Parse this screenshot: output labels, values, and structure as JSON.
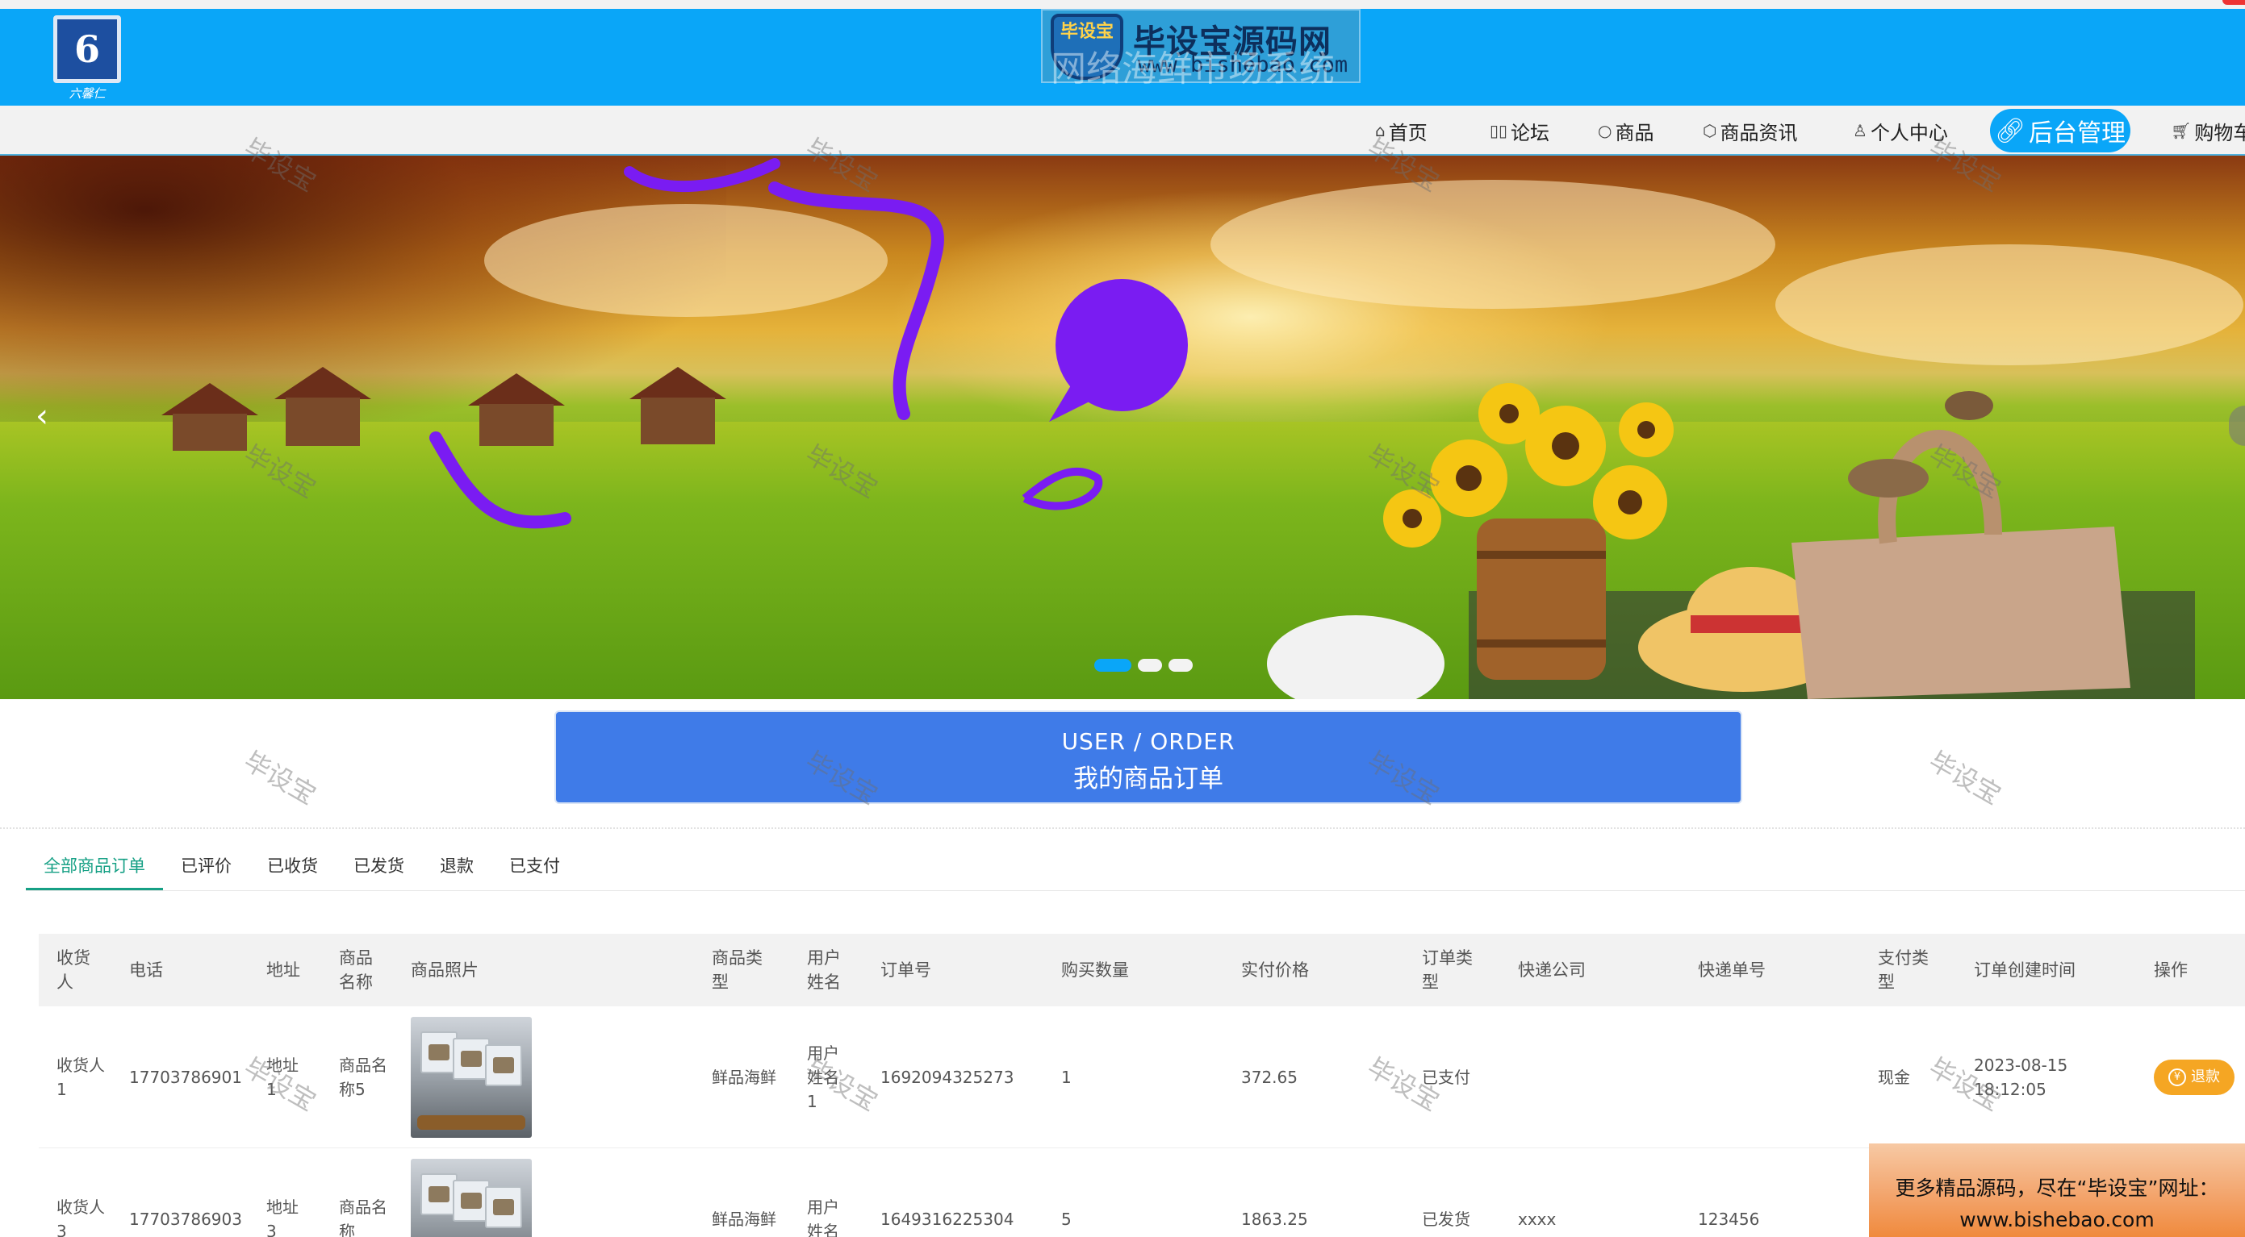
{
  "header": {
    "logo_text": "6",
    "logo_sub": "六馨仁",
    "watermark_banner": {
      "shield_text": "毕设宝",
      "title": "毕设宝源码网",
      "url": "www.bishebao.com",
      "overlay": "网络海鲜市场系统"
    }
  },
  "nav": {
    "items": [
      {
        "label": "首页",
        "icon": "home-icon"
      },
      {
        "label": "论坛",
        "icon": "forum-icon"
      },
      {
        "label": "商品",
        "icon": "circle-icon"
      },
      {
        "label": "商品资讯",
        "icon": "cube-icon"
      },
      {
        "label": "个人中心",
        "icon": "user-icon"
      }
    ],
    "admin_label": "后台管理",
    "cart_label": "购物车"
  },
  "banner": {
    "prev_icon": "chevron-left-icon",
    "slides_count": 3,
    "active_slide": 1
  },
  "order_section": {
    "title_en": "USER / ORDER",
    "title_cn": "我的商品订单"
  },
  "tabs": [
    {
      "label": "全部商品订单",
      "active": true
    },
    {
      "label": "已评价",
      "active": false
    },
    {
      "label": "已收货",
      "active": false
    },
    {
      "label": "已发货",
      "active": false
    },
    {
      "label": "退款",
      "active": false
    },
    {
      "label": "已支付",
      "active": false
    }
  ],
  "table": {
    "headers": [
      "收货人",
      "电话",
      "地址",
      "商品名称",
      "商品照片",
      "商品类型",
      "用户姓名",
      "订单号",
      "购买数量",
      "实付价格",
      "订单类型",
      "快递公司",
      "快递单号",
      "支付类型",
      "订单创建时间",
      "操作"
    ],
    "rows": [
      {
        "receiver": "收货人1",
        "phone": "17703786901",
        "address": "地址1",
        "product_name": "商品名称5",
        "product_type": "鲜品海鲜",
        "user_name": "用户姓名1",
        "order_no": "1692094325273",
        "quantity": "1",
        "price": "372.65",
        "order_type": "已支付",
        "courier": "",
        "tracking_no": "",
        "pay_type": "现金",
        "created": "2023-08-15 18:12:05",
        "action": "退款"
      },
      {
        "receiver": "收货人3",
        "phone": "17703786903",
        "address": "地址3",
        "product_name": "商品名称",
        "product_type": "鲜品海鲜",
        "user_name": "用户姓名",
        "order_no": "1649316225304",
        "quantity": "5",
        "price": "1863.25",
        "order_type": "已发货",
        "courier": "xxxx",
        "tracking_no": "123456",
        "pay_type": "",
        "created": "",
        "action": ""
      }
    ]
  },
  "watermark_text": "毕设宝",
  "ad": {
    "line1": "更多精品源码，尽在“毕设宝”网址：",
    "line2": "www.bishebao.com"
  },
  "colors": {
    "header_bg": "#0aa6f8",
    "order_title_bg": "#3f7be8",
    "tab_active": "#16a085",
    "refund_button": "#f5a623"
  }
}
